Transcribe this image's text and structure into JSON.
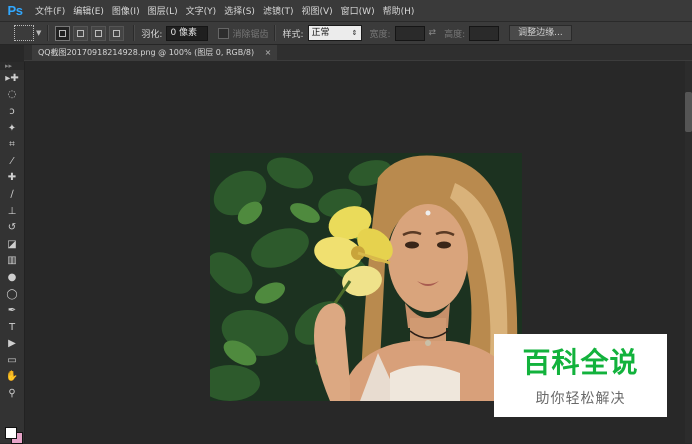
{
  "app": {
    "logo": "Ps"
  },
  "menu": [
    "文件(F)",
    "编辑(E)",
    "图像(I)",
    "图层(L)",
    "文字(Y)",
    "选择(S)",
    "滤镜(T)",
    "视图(V)",
    "窗口(W)",
    "帮助(H)"
  ],
  "options": {
    "feather_label": "羽化:",
    "feather_value": "0 像素",
    "antialias_label": "消除锯齿",
    "style_label": "样式:",
    "style_value": "正常",
    "width_label": "宽度:",
    "height_label": "高度:",
    "refine_edge_button": "调整边缘..."
  },
  "document": {
    "tab_title": "QQ截图20170918214928.png @ 100% (图层 0, RGB/8)",
    "close_glyph": "×"
  },
  "toolbox": {
    "tools": [
      "move-icon",
      "marquee-ellipse-icon",
      "lasso-icon",
      "magic-wand-icon",
      "crop-icon",
      "eyedropper-icon",
      "healing-brush-icon",
      "brush-icon",
      "clone-stamp-icon",
      "history-brush-icon",
      "eraser-icon",
      "gradient-icon",
      "blur-icon",
      "dodge-icon",
      "pen-icon",
      "type-icon",
      "path-selection-icon",
      "shape-icon",
      "hand-icon",
      "zoom-icon"
    ],
    "glyphs": [
      "▸✚",
      "◌",
      "ↄ",
      "✦",
      "⌗",
      "⁄",
      "✚",
      "∕",
      "⊥",
      "↺",
      "◪",
      "▥",
      "●",
      "◯",
      "✒",
      "T",
      "▶",
      "▭",
      "✋",
      "⚲"
    ],
    "foreground_color": "#ffffff",
    "background_color": "#e6a3c7"
  },
  "watermark": {
    "title": "百科全说",
    "subtitle": "助你轻松解决",
    "title_color": "#12b23c"
  }
}
